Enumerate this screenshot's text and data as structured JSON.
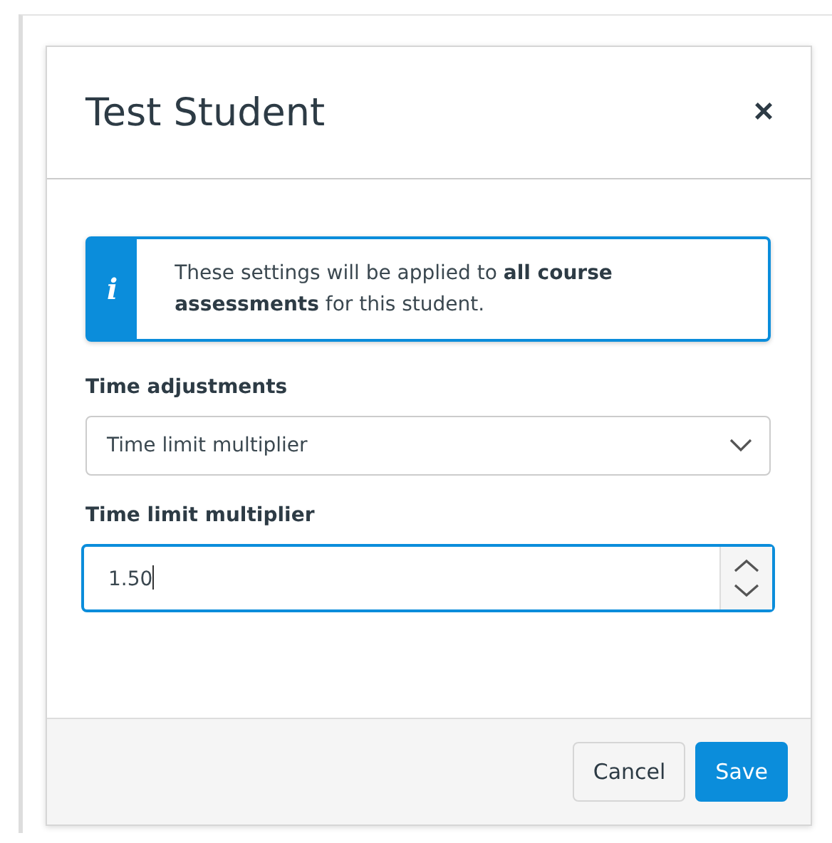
{
  "dialog": {
    "title": "Test Student",
    "close": "×"
  },
  "notice": {
    "icon": "i",
    "text": "These settings will be applied to **all course assessments** for this student."
  },
  "fields": [
    {
      "kind": "select",
      "label": "Time adjustments",
      "value": "Time limit multiplier",
      "focused": false
    },
    {
      "kind": "number",
      "label": "Time limit multiplier",
      "value": "1.50",
      "focused": true
    }
  ],
  "buttons": [
    {
      "label": "Cancel",
      "kind": "secondary"
    },
    {
      "label": "Save",
      "kind": "primary"
    }
  ]
}
